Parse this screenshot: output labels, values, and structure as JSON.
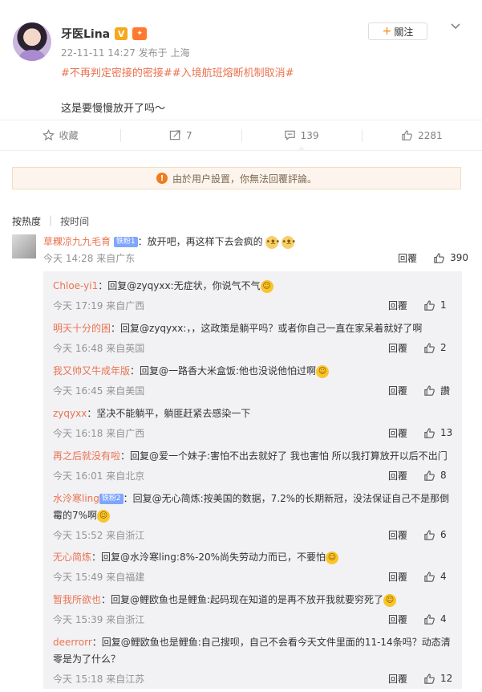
{
  "post": {
    "author": "牙医Lina",
    "v_badge": "V",
    "meta": "22-11-11 14:27 发布于 上海",
    "topics": "#不再判定密接的密接##入境航班熔断机制取消#",
    "text": "这是要慢慢放开了吗～",
    "follow_label": "關注",
    "follow_plus": "+"
  },
  "actions": {
    "fav_label": "收藏",
    "repost_count": "7",
    "comment_count": "139",
    "like_count": "2281"
  },
  "notice": {
    "icon": "!",
    "text": "由於用户設置，你無法回覆評論。"
  },
  "sort": {
    "hot": "按热度",
    "sep": "|",
    "time": "按时间"
  },
  "top_comment": {
    "user": "草粿凉九九毛育",
    "badge": "铁粉1",
    "text": "：放开吧，再这样下去会疯的",
    "time": "今天 14:28 来自广东",
    "reply": "回覆",
    "likes": "390"
  },
  "replies": [
    {
      "user": "Chloe-yi1",
      "text": "：回复@zyqyxx:无症状，你说气不气",
      "time": "今天 17:19 来自广西",
      "reply": "回覆",
      "likes": "1"
    },
    {
      "user": "明天十分的困",
      "text": "：回复@zyqyxx:，，这政策是躺平吗？或者你自己一直在家呆着就好了啊",
      "time": "今天 16:48 来自英国",
      "reply": "回覆",
      "likes": "2"
    },
    {
      "user": "我又帅又牛成年版",
      "text": "：回复@一路香大米盒饭:他也没说他怕过啊",
      "time": "今天 16:45 来自美国",
      "reply": "回覆",
      "likes": "讚"
    },
    {
      "user": "zyqyxx",
      "text": "：坚决不能躺平，躺匪赶紧去感染一下",
      "time": "今天 16:18 来自广西",
      "reply": "回覆",
      "likes": "13"
    },
    {
      "user": "再之后就没有啦",
      "text": "：回复@爱一个妹子:害怕不出去就好了 我也害怕 所以我打算放开以后不出门",
      "time": "今天 16:01 来自北京",
      "reply": "回覆",
      "likes": "8"
    },
    {
      "user": "水泠寒ling",
      "badge": "铁粉2",
      "text": "：回复@无心简炼:按美国的数据，7.2%的长期新冠，没法保证自己不是那倒霉的7%啊",
      "time": "今天 15:52 来自浙江",
      "reply": "回覆",
      "likes": "6"
    },
    {
      "user": "无心简炼",
      "text": "：回复@水泠寒ling:8%-20%尚失劳动力而已，不要怕",
      "time": "今天 15:49 来自福建",
      "reply": "回覆",
      "likes": "4"
    },
    {
      "user": "暂我所欲也",
      "text": "：回复@鲤欧鱼也是鲤鱼:起码现在知道的是再不放开我就要穷死了",
      "time": "今天 15:39 来自浙江",
      "reply": "回覆",
      "likes": "4"
    },
    {
      "user": "deerrorr",
      "text": "：回复@鲤欧鱼也是鲤鱼:自己搜呗，自己不会看今天文件里面的11-14条吗？动态清零是为了什么？",
      "time": "今天 15:18 来自江苏",
      "reply": "回覆",
      "likes": "12"
    }
  ]
}
